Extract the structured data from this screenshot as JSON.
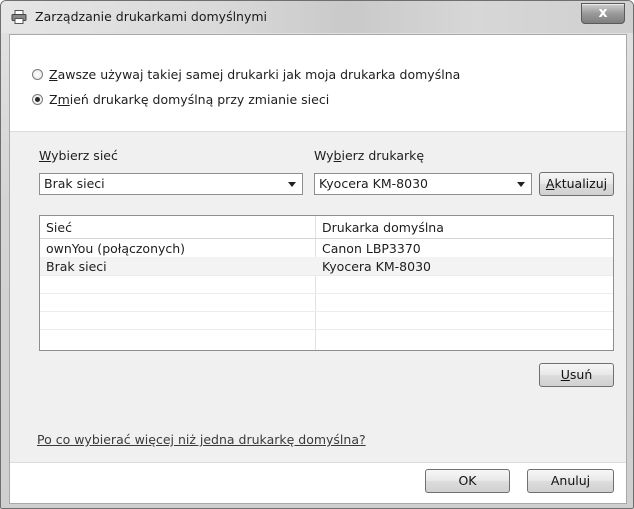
{
  "window": {
    "title": "Zarządzanie drukarkami domyślnymi",
    "close_label": "x"
  },
  "options": {
    "always_same_prefix": "Z",
    "always_same_rest": "awsze używaj takiej samej drukarki jak moja drukarka domyślna",
    "change_prefix": "Z",
    "change_mn": "m",
    "change_rest": "ień drukarkę domyślną przy zmianie sieci",
    "selected": "change"
  },
  "network": {
    "label_u": "W",
    "label_rest": "ybierz sieć",
    "value": "Brak sieci"
  },
  "printer": {
    "label_a": "Wy",
    "label_u": "b",
    "label_b": "ierz drukarkę",
    "value": "Kyocera KM-8030"
  },
  "update_button": {
    "u": "A",
    "rest": "ktualizuj"
  },
  "table": {
    "headers": [
      "Sieć",
      "Drukarka domyślna"
    ],
    "rows": [
      [
        "ownYou (połączonych)",
        "Canon LBP3370"
      ],
      [
        "Brak sieci",
        "Kyocera KM-8030"
      ]
    ]
  },
  "remove_button": {
    "u": "U",
    "rest": "suń"
  },
  "help_link": "Po co wybierać więcej niż jedna drukarkę domyślna?",
  "footer": {
    "ok": "OK",
    "cancel": "Anuluj"
  }
}
